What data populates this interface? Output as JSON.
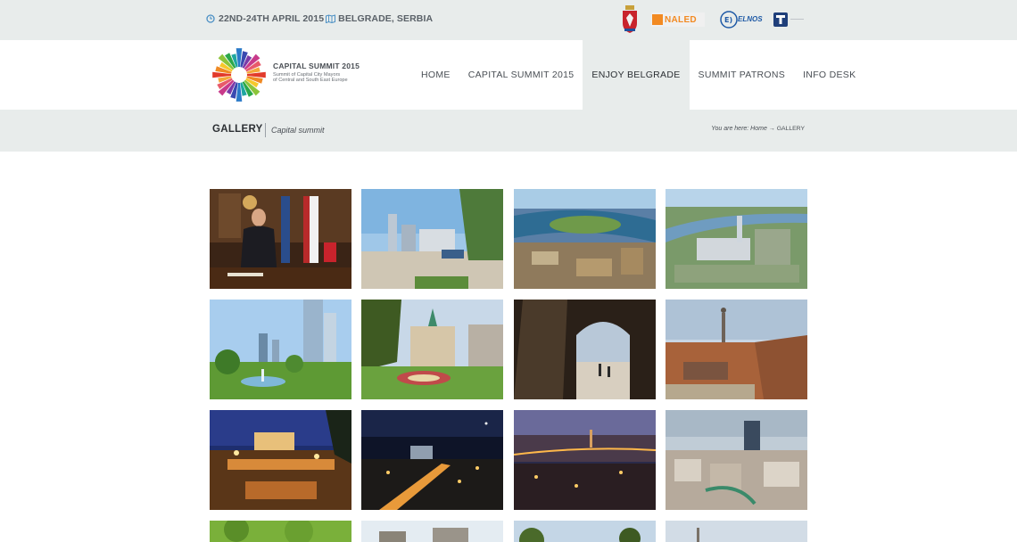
{
  "topbar": {
    "date": "22ND-24TH APRIL 2015",
    "location": "BELGRADE, SERBIA",
    "sponsors": [
      "coat-of-arms",
      "NALED",
      "ELNOS",
      "Telekom"
    ]
  },
  "logo": {
    "title": "CAPITAL SUMMIT 2015",
    "subtitle_line1": "Summit of Capital City Mayors",
    "subtitle_line2": "of Central and South East Europe"
  },
  "nav": {
    "items": [
      "HOME",
      "CAPITAL SUMMIT 2015",
      "ENJOY BELGRADE",
      "SUMMIT PATRONS",
      "INFO DESK"
    ],
    "active": "ENJOY BELGRADE"
  },
  "page": {
    "title": "GALLERY",
    "subtitle": "Capital summit",
    "breadcrumb_prefix": "You are here: Home",
    "breadcrumb_arrow": "→",
    "breadcrumb_current": "GALLERY"
  },
  "gallery": {
    "photos": [
      {
        "label": "photo-mayor-office"
      },
      {
        "label": "photo-waterfront-rendering"
      },
      {
        "label": "photo-aerial-river-rendering"
      },
      {
        "label": "photo-aerial-city-rendering"
      },
      {
        "label": "photo-park-towers-rendering"
      },
      {
        "label": "photo-parliament-garden"
      },
      {
        "label": "photo-fortress-gate"
      },
      {
        "label": "photo-fortress-victor-monument"
      },
      {
        "label": "photo-fortress-night-lights"
      },
      {
        "label": "photo-city-night-aerial"
      },
      {
        "label": "photo-city-dusk-bridges"
      },
      {
        "label": "photo-city-skyline-day"
      },
      {
        "label": "photo-trees"
      },
      {
        "label": "photo-rooftops"
      },
      {
        "label": "photo-treetops-sky"
      },
      {
        "label": "photo-monument-sky"
      }
    ]
  }
}
